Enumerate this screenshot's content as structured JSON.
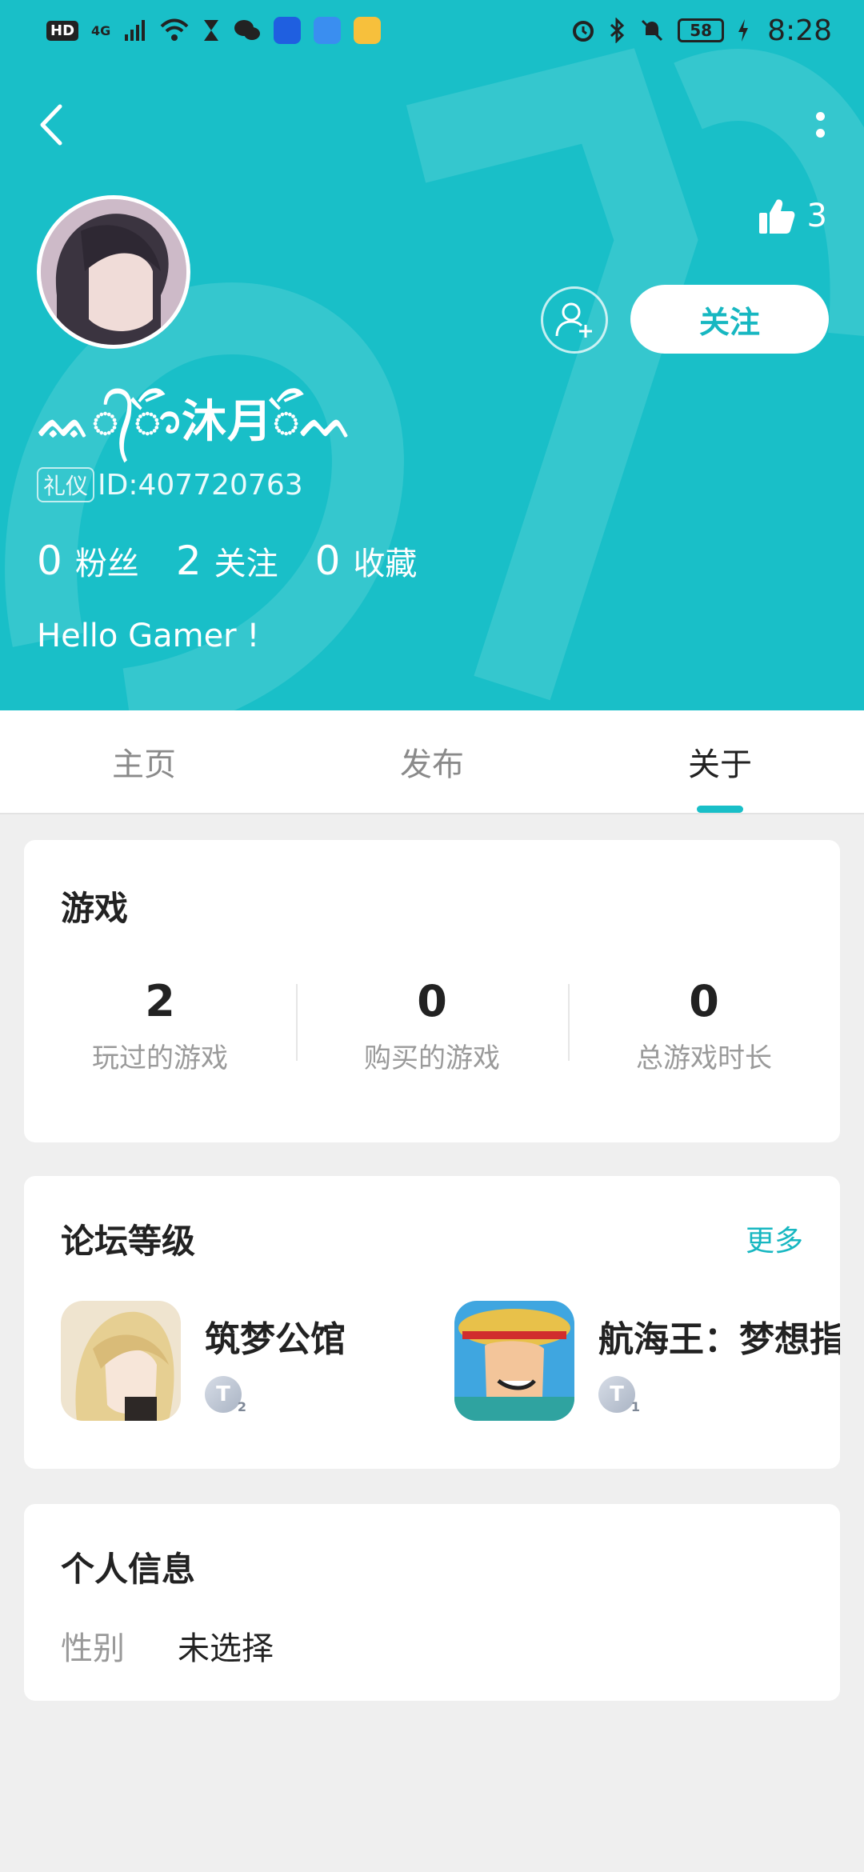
{
  "status_bar": {
    "hd": "HD",
    "network": "4G",
    "battery": "58",
    "time": "8:28"
  },
  "profile": {
    "likes": "3",
    "follow_label": "关注",
    "nickname": "ᨐ᭄ᭃ沐月ᭂᨓ",
    "id_badge": "礼仪",
    "id_text": "ID:407720763",
    "stats": [
      {
        "num": "0",
        "label": "粉丝"
      },
      {
        "num": "2",
        "label": "关注"
      },
      {
        "num": "0",
        "label": "收藏"
      }
    ],
    "bio": "Hello Gamer !"
  },
  "tabs": [
    {
      "label": "主页",
      "active": false
    },
    {
      "label": "发布",
      "active": false
    },
    {
      "label": "关于",
      "active": true
    }
  ],
  "games_card": {
    "title": "游戏",
    "stats": [
      {
        "num": "2",
        "label": "玩过的游戏"
      },
      {
        "num": "0",
        "label": "购买的游戏"
      },
      {
        "num": "0",
        "label": "总游戏时长"
      }
    ]
  },
  "forum_card": {
    "title": "论坛等级",
    "more": "更多",
    "items": [
      {
        "name": "筑梦公馆",
        "level": "T",
        "level_num": "2"
      },
      {
        "name": "航海王：梦想指",
        "level": "T",
        "level_num": "1"
      }
    ]
  },
  "info_card": {
    "title": "个人信息",
    "rows": [
      {
        "key": "性别",
        "value": "未选择"
      }
    ]
  },
  "colors": {
    "accent": "#19bfc8",
    "follow_text": "#17b7c1"
  }
}
